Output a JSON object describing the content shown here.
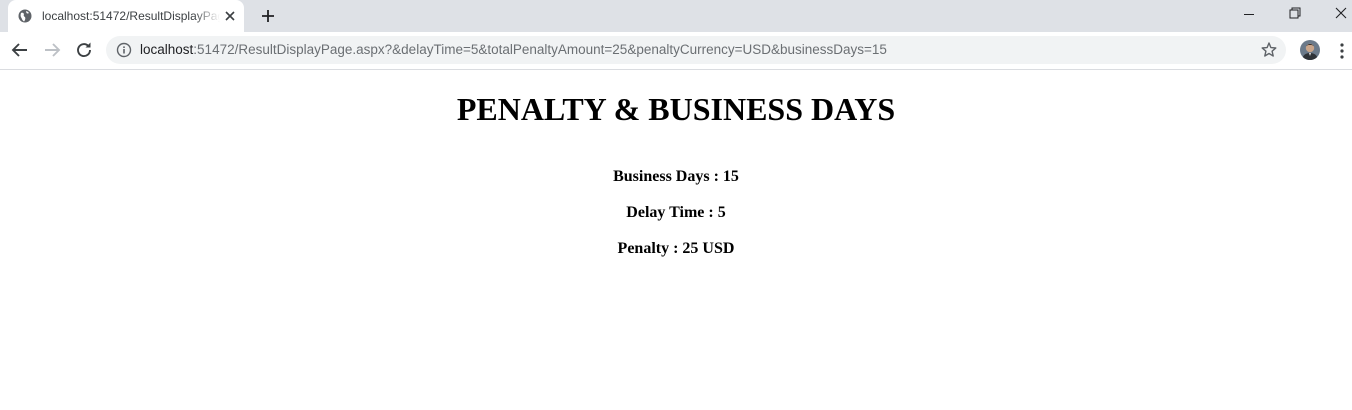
{
  "browser": {
    "tab": {
      "title": "localhost:51472/ResultDisplayPage.aspx?&delayTime=5&totalPenaltyAmount=25&penaltyCurrency=USD&businessDays=15"
    },
    "address_bar": {
      "host": "localhost",
      "rest": ":51472/ResultDisplayPage.aspx?&delayTime=5&totalPenaltyAmount=25&penaltyCurrency=USD&businessDays=15"
    }
  },
  "page": {
    "title": "PENALTY & BUSINESS DAYS",
    "results": [
      {
        "text": "Business Days : 15"
      },
      {
        "text": "Delay Time : 5"
      },
      {
        "text": "Penalty : 25 USD"
      }
    ]
  },
  "icons": {
    "favicon": "globe-icon",
    "tab_close": "close-icon",
    "new_tab": "plus-icon",
    "back": "arrow-left-icon",
    "forward": "arrow-right-icon",
    "reload": "reload-icon",
    "site_info": "info-icon",
    "bookmark": "star-icon",
    "menu": "kebab-menu-icon"
  },
  "colors": {
    "tabstrip_bg": "#dee1e6",
    "omnibox_bg": "#f1f3f4",
    "url_host": "#202124",
    "url_rest": "#6b6f73",
    "text": "#000000"
  }
}
